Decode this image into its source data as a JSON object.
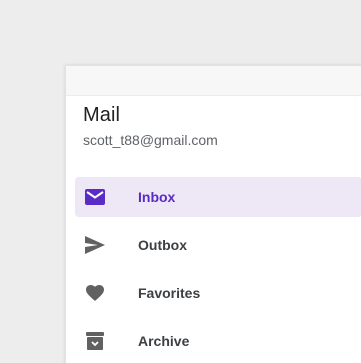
{
  "account": {
    "title": "Mail",
    "email": "scott_t88@gmail.com"
  },
  "nav": {
    "items": [
      {
        "label": "Inbox",
        "icon": "mail-icon",
        "active": true
      },
      {
        "label": "Outbox",
        "icon": "send-icon",
        "active": false
      },
      {
        "label": "Favorites",
        "icon": "heart-icon",
        "active": false
      },
      {
        "label": "Archive",
        "icon": "archive-icon",
        "active": false
      }
    ]
  },
  "colors": {
    "accent": "#5b2bc6",
    "active_bg": "#ede7f6",
    "icon": "#616161"
  }
}
